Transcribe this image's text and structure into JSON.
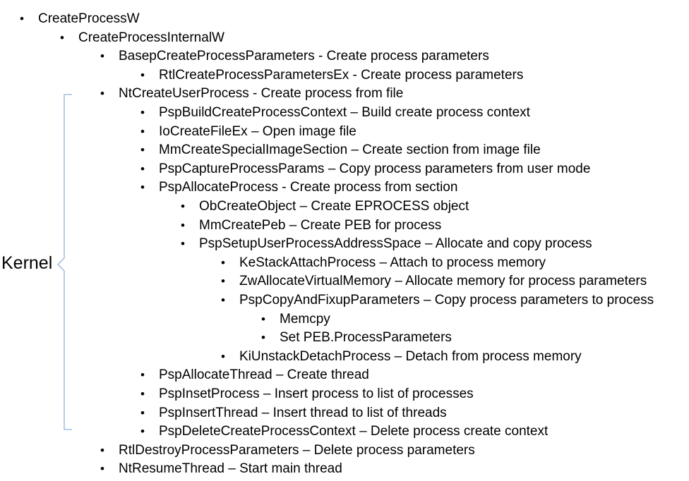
{
  "bracket": {
    "label": "Kernel",
    "color": "#8fb4dc"
  },
  "outline": [
    {
      "level": 0,
      "text": "CreateProcessW"
    },
    {
      "level": 1,
      "text": "CreateProcessInternalW"
    },
    {
      "level": 2,
      "text": "BasepCreateProcessParameters - Create process parameters"
    },
    {
      "level": 3,
      "text": "RtlCreateProcessParametersEx - Create process parameters"
    },
    {
      "level": 2,
      "text": "NtCreateUserProcess - Create process from file"
    },
    {
      "level": 3,
      "text": "PspBuildCreateProcessContext – Build create process context"
    },
    {
      "level": 3,
      "text": "IoCreateFileEx – Open image file"
    },
    {
      "level": 3,
      "text": "MmCreateSpecialImageSection – Create section from image file"
    },
    {
      "level": 3,
      "text": "PspCaptureProcessParams – Copy process parameters from user mode"
    },
    {
      "level": 3,
      "text": "PspAllocateProcess - Create process from section"
    },
    {
      "level": 4,
      "text": "ObCreateObject – Create EPROCESS object"
    },
    {
      "level": 4,
      "text": "MmCreatePeb – Create PEB for process"
    },
    {
      "level": 4,
      "text": "PspSetupUserProcessAddressSpace – Allocate and copy process"
    },
    {
      "level": 5,
      "text": "KeStackAttachProcess – Attach to process memory"
    },
    {
      "level": 5,
      "text": "ZwAllocateVirtualMemory – Allocate memory for process parameters"
    },
    {
      "level": 5,
      "text": "PspCopyAndFixupParameters – Copy process parameters to process"
    },
    {
      "level": 6,
      "text": "Memcpy"
    },
    {
      "level": 6,
      "text": "Set PEB.ProcessParameters"
    },
    {
      "level": 5,
      "text": "KiUnstackDetachProcess – Detach from process memory"
    },
    {
      "level": 3,
      "text": "PspAllocateThread – Create thread"
    },
    {
      "level": 3,
      "text": "PspInsetProcess – Insert process to list of processes"
    },
    {
      "level": 3,
      "text": "PspInsertThread – Insert thread to list of threads"
    },
    {
      "level": 3,
      "text": "PspDeleteCreateProcessContext – Delete process create context"
    },
    {
      "level": 2,
      "text": "RtlDestroyProcessParameters – Delete process parameters"
    },
    {
      "level": 2,
      "text": "NtResumeThread – Start main thread"
    }
  ]
}
